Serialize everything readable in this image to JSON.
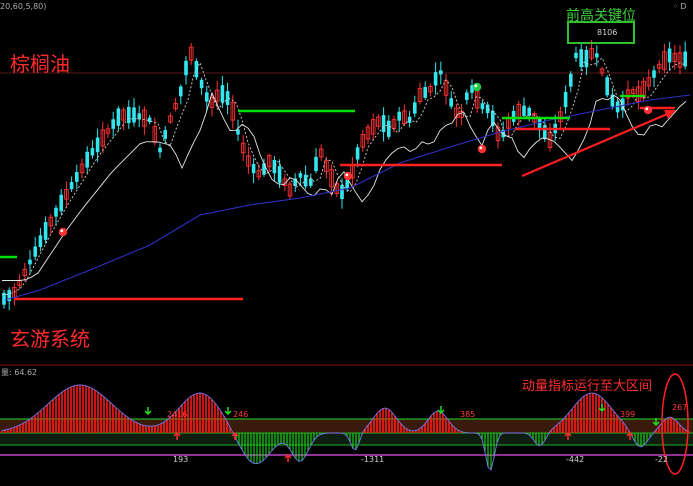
{
  "colors": {
    "background": "#000000",
    "up_candle": "#ff3232",
    "down_candle": "#33e6ee",
    "ma_short": "#d0d0d0",
    "ma_mid": "#e6e6e6",
    "ma_long": "#3030c8",
    "support": "#ff2020",
    "resistance": "#00e000",
    "hist_up": "#ff1a1a",
    "hist_down": "#1bd81b",
    "band_green": "#22b022",
    "band_magenta": "#c040c0",
    "circle": "#ff2020"
  },
  "main": {
    "param_text": "20,60,5,80)",
    "corner_text": "D",
    "commodity_label": "棕榈油",
    "system_label": "玄游系统",
    "key_level_label": "前高关键位",
    "key_level_price": "8106"
  },
  "sub": {
    "indicator_head": "量: 64.62",
    "note": "动量指标运行至大区间",
    "labels": {
      "v2416": "2416",
      "v246": "246",
      "v193": "193",
      "vneg1311": "-1311",
      "v385": "385",
      "vneg442": "-442",
      "v399": "399",
      "v2678": "267",
      "vneg22": "-22"
    }
  }
}
